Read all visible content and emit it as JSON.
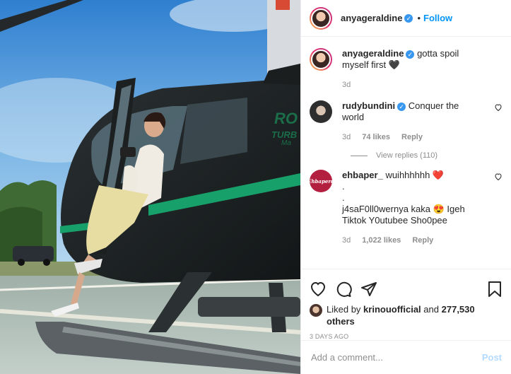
{
  "post": {
    "author": "anyageraldine",
    "follow_label": "Follow",
    "dot": "•",
    "verified_glyph": "✓",
    "caption": {
      "text": "gotta spoil myself first 🖤",
      "age": "3d"
    }
  },
  "comments": [
    {
      "user": "rudybundini",
      "verified": true,
      "text": "Conquer the world",
      "age": "3d",
      "likes": "74 likes",
      "reply_label": "Reply",
      "view_replies": "View replies (110)"
    },
    {
      "user": "ehbaper_",
      "verified": false,
      "avatar_text": "Ehbaperd",
      "text": "wuihhhhhh ❤️\n.\n.\nj4saF0ll0wernya kaka 😍 Igeh Tiktok Y0utubee Sho0pee",
      "age": "3d",
      "likes": "1,022 likes",
      "reply_label": "Reply"
    }
  ],
  "actions": {
    "liked_prefix": "Liked by",
    "liked_user": "krinouofficial",
    "liked_and": "and",
    "liked_others": "277,530 others",
    "date": "3 DAYS AGO"
  },
  "add_comment": {
    "placeholder": "Add a comment...",
    "post_label": "Post"
  },
  "colors": {
    "accent": "#0095f6",
    "verified": "#3897f0",
    "muted": "#8e8e8e",
    "post_disabled": "#b3dbff"
  },
  "icons": [
    "heart-icon",
    "comment-icon",
    "share-icon",
    "bookmark-icon",
    "verified-badge-icon"
  ]
}
